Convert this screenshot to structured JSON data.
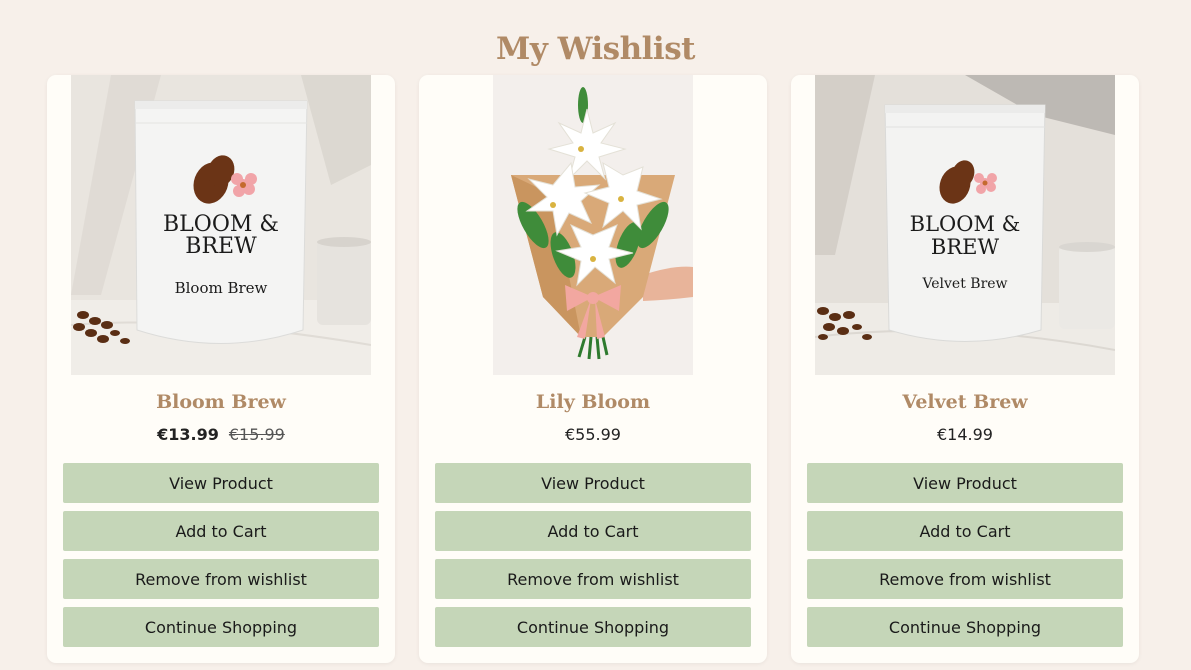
{
  "page": {
    "title": "My Wishlist"
  },
  "products": [
    {
      "name": "Bloom Brew",
      "price": "€13.99",
      "old_price": "€15.99",
      "image": {
        "brand_line1": "BLOOM &",
        "brand_line2": "BREW",
        "variant": "Bloom Brew"
      }
    },
    {
      "name": "Lily Bloom",
      "price": "€55.99",
      "old_price": null,
      "image": {}
    },
    {
      "name": "Velvet Brew",
      "price": "€14.99",
      "old_price": null,
      "image": {
        "brand_line1": "BLOOM &",
        "brand_line2": "BREW",
        "variant": "Velvet Brew"
      }
    }
  ],
  "buttons": {
    "view": "View Product",
    "add_to_cart": "Add to Cart",
    "remove": "Remove from wishlist",
    "continue": "Continue Shopping"
  },
  "colors": {
    "background": "#f7f0ea",
    "card": "#fffdf8",
    "title": "#b08a66",
    "button": "#c5d6b8"
  }
}
